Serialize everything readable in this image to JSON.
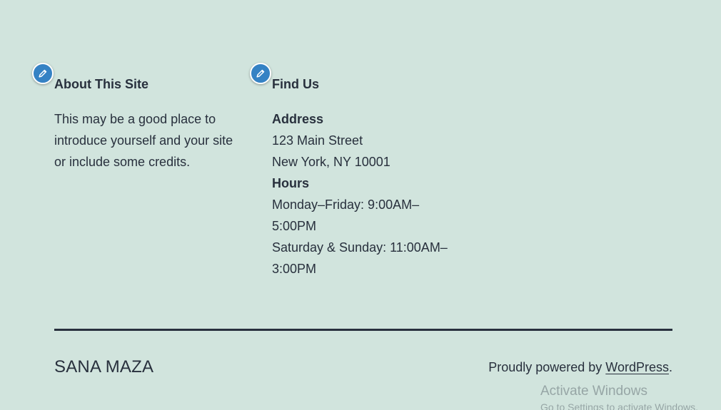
{
  "widgets": {
    "about": {
      "title": "About This Site",
      "text": "This may be a good place to introduce yourself and your site or include some credits."
    },
    "find": {
      "title": "Find Us",
      "address_heading": "Address",
      "address_line1": "123 Main Street",
      "address_line2": "New York, NY 10001",
      "hours_heading": "Hours",
      "hours_weekday_line1": "Monday–Friday: 9:00AM–",
      "hours_weekday_line2": "5:00PM",
      "hours_weekend_line1": "Saturday & Sunday: 11:00AM–",
      "hours_weekend_line2": "3:00PM"
    }
  },
  "footer": {
    "site_name": "SANA MAZA",
    "powered_prefix": "Proudly powered by ",
    "powered_link": "WordPress",
    "powered_suffix": "."
  },
  "overlay": {
    "activate_title": "Activate Windows",
    "activate_subtitle": "Go to Settings to activate Windows."
  },
  "colors": {
    "background": "#d1e4dd",
    "text": "#28303d",
    "edit_button": "#3582c4"
  },
  "icons": {
    "edit_shortcut": "pencil-icon"
  }
}
